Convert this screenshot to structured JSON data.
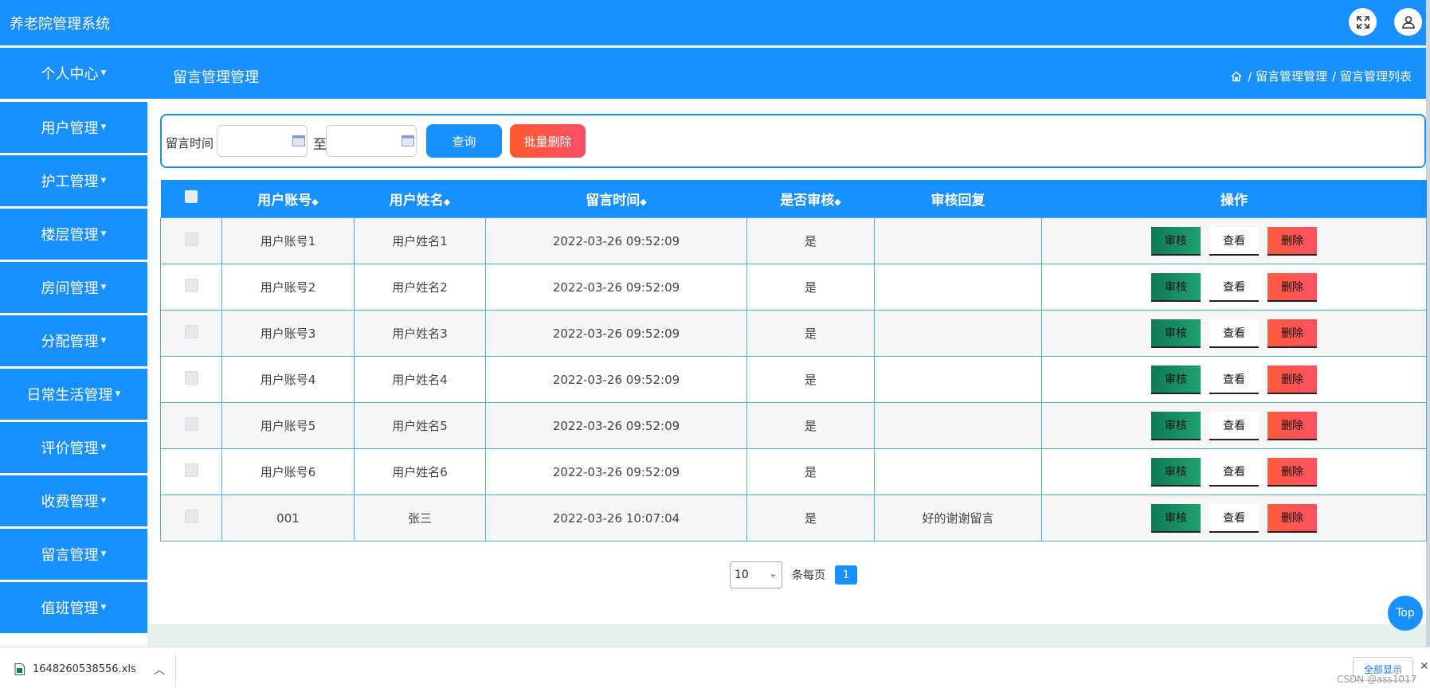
{
  "app": {
    "title": "养老院管理系统"
  },
  "header": {
    "fullscreen_icon": "expand-icon",
    "user_icon": "user-icon"
  },
  "sidebar": {
    "items": [
      {
        "label": "个人中心"
      },
      {
        "label": "用户管理"
      },
      {
        "label": "护工管理"
      },
      {
        "label": "楼层管理"
      },
      {
        "label": "房间管理"
      },
      {
        "label": "分配管理"
      },
      {
        "label": "日常生活管理"
      },
      {
        "label": "评价管理"
      },
      {
        "label": "收费管理"
      },
      {
        "label": "留言管理"
      },
      {
        "label": "值班管理"
      }
    ]
  },
  "page": {
    "title": "留言管理管理",
    "breadcrumb": [
      "/ 留言管理管理",
      "/ 留言管理列表"
    ]
  },
  "search": {
    "label": "留言时间",
    "start_value": "",
    "end_value": "",
    "separator": "至",
    "query_label": "查询",
    "batch_delete_label": "批量删除"
  },
  "table": {
    "columns": [
      "",
      "用户账号",
      "用户姓名",
      "留言时间",
      "是否审核",
      "审核回复",
      "操作"
    ],
    "sortable": [
      false,
      true,
      true,
      true,
      true,
      false,
      false
    ],
    "rows": [
      {
        "account": "用户账号1",
        "name": "用户姓名1",
        "time": "2022-03-26 09:52:09",
        "reviewed": "是",
        "reply": ""
      },
      {
        "account": "用户账号2",
        "name": "用户姓名2",
        "time": "2022-03-26 09:52:09",
        "reviewed": "是",
        "reply": ""
      },
      {
        "account": "用户账号3",
        "name": "用户姓名3",
        "time": "2022-03-26 09:52:09",
        "reviewed": "是",
        "reply": ""
      },
      {
        "account": "用户账号4",
        "name": "用户姓名4",
        "time": "2022-03-26 09:52:09",
        "reviewed": "是",
        "reply": ""
      },
      {
        "account": "用户账号5",
        "name": "用户姓名5",
        "time": "2022-03-26 09:52:09",
        "reviewed": "是",
        "reply": ""
      },
      {
        "account": "用户账号6",
        "name": "用户姓名6",
        "time": "2022-03-26 09:52:09",
        "reviewed": "是",
        "reply": ""
      },
      {
        "account": "001",
        "name": "张三",
        "time": "2022-03-26 10:07:04",
        "reviewed": "是",
        "reply": "好的谢谢留言"
      }
    ],
    "actions": {
      "review": "审核",
      "view": "查看",
      "delete": "删除"
    }
  },
  "pagination": {
    "page_size": "10",
    "per_page_label": "条每页",
    "current_page": "1"
  },
  "top_button": {
    "label": "Top"
  },
  "download_bar": {
    "file_name": "1648260538556.xls",
    "show_all": "全部显示",
    "watermark": "CSDN @ass1017"
  },
  "colors": {
    "primary": "#1890ff",
    "danger": "#ff5062",
    "review": "#0e7a56"
  }
}
